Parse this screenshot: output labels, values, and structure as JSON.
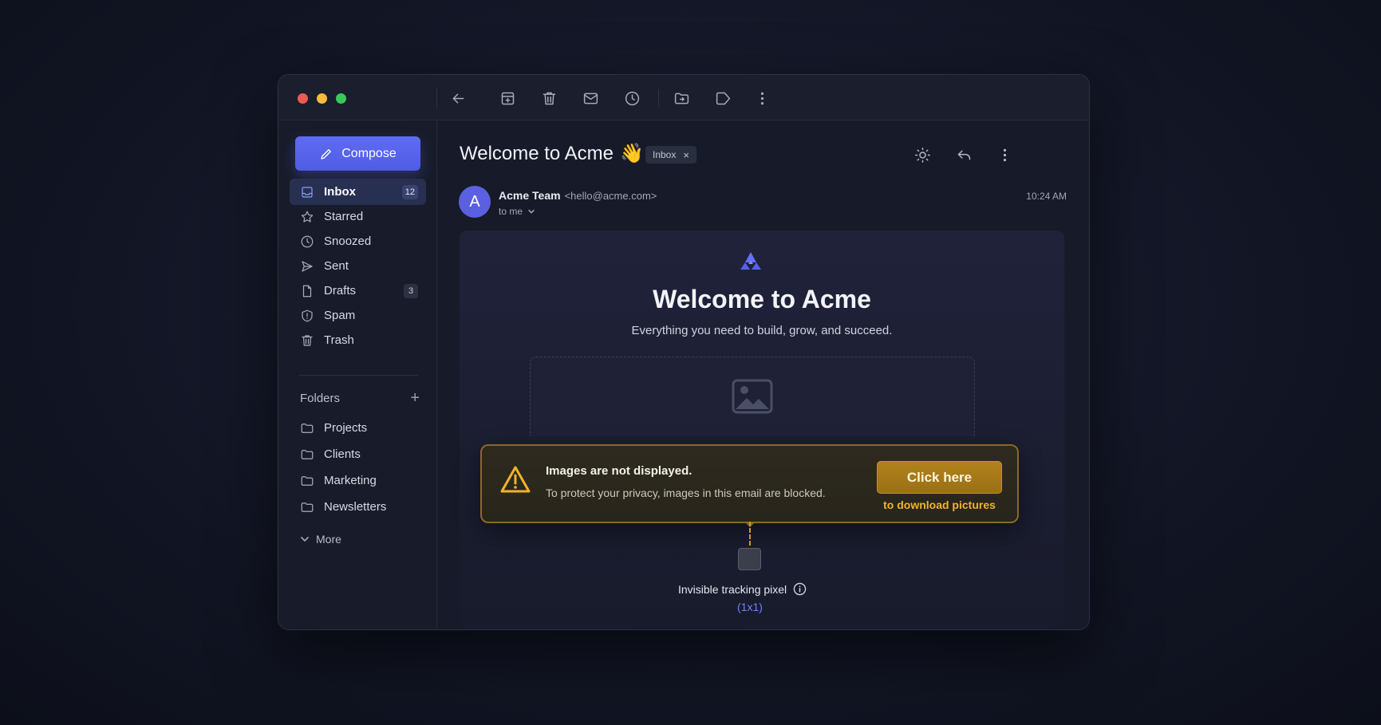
{
  "window": {
    "toolbar_icons": [
      "back-arrow-icon",
      "archive-icon",
      "trash-icon",
      "mail-icon",
      "clock-icon",
      "folder-move-icon",
      "label-icon",
      "more-vertical-icon"
    ]
  },
  "sidebar": {
    "compose_label": "Compose",
    "items": [
      {
        "label": "Inbox",
        "icon": "inbox-icon",
        "count": "12",
        "active": true
      },
      {
        "label": "Starred",
        "icon": "star-icon",
        "count": ""
      },
      {
        "label": "Snoozed",
        "icon": "clock-icon",
        "count": ""
      },
      {
        "label": "Sent",
        "icon": "send-icon",
        "count": ""
      },
      {
        "label": "Drafts",
        "icon": "file-icon",
        "count": "3"
      },
      {
        "label": "Spam",
        "icon": "shield-icon",
        "count": ""
      },
      {
        "label": "Trash",
        "icon": "trash-icon",
        "count": ""
      }
    ],
    "folders_heading": "Folders",
    "folders": [
      {
        "label": "Projects"
      },
      {
        "label": "Clients"
      },
      {
        "label": "Marketing"
      },
      {
        "label": "Newsletters"
      }
    ],
    "more_label": "More"
  },
  "message": {
    "subject": "Welcome to Acme",
    "subject_emoji": "👋",
    "tag_label": "Inbox",
    "sender_initial": "A",
    "sender_name": "Acme Team",
    "sender_email": "<hello@acme.com>",
    "recipient": "to me",
    "time": "10:24 AM",
    "body": {
      "title": "Welcome to Acme",
      "subtitle": "Everything you need to build, grow, and succeed."
    }
  },
  "warning": {
    "title": "Images are not displayed.",
    "description": "To protect your privacy, images in this email are blocked.",
    "button_label": "Click here",
    "link_label": "to download pictures"
  },
  "tracking": {
    "label": "Invisible tracking pixel",
    "size": "(1x1)"
  },
  "colors": {
    "accent": "#5b66ec",
    "warning": "#f0b429",
    "background": "#171b29"
  }
}
